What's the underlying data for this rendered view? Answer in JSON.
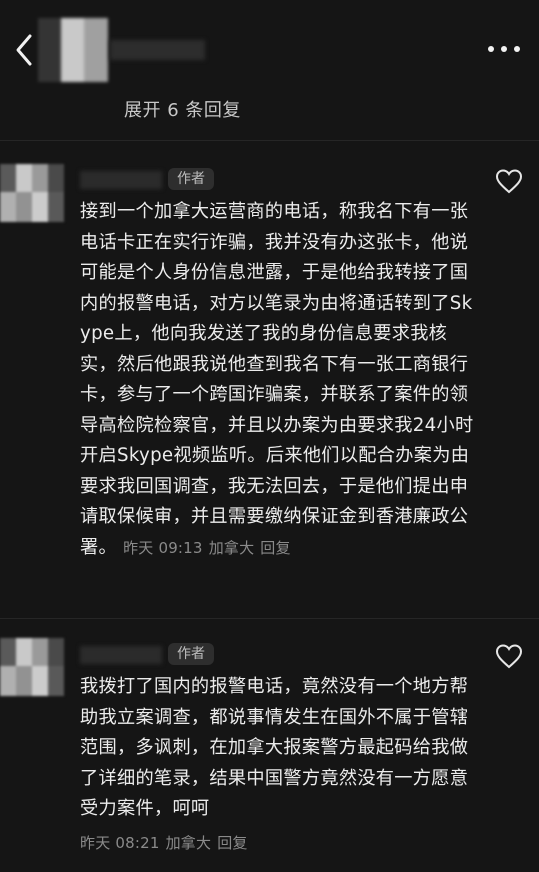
{
  "header": {
    "back_icon": "chevron-left-icon",
    "more_icon": "more-horizontal-icon",
    "expand_replies": "展开 6 条回复"
  },
  "comments": [
    {
      "author_badge": "作者",
      "text": "接到一个加拿大运营商的电话，称我名下有一张电话卡正在实行诈骗，我并没有办这张卡，他说可能是个人身份信息泄露，于是他给我转接了国内的报警电话，对方以笔录为由将通话转到了Skype上，他向我发送了我的身份信息要求我核实，然后他跟我说他查到我名下有一张工商银行卡，参与了一个跨国诈骗案，并联系了案件的领导高检院检察官，并且以办案为由要求我24小时开启Skype视频监听。后来他们以配合办案为由要求我回国调查，我无法回去，于是他们提出申请取保候审，并且需要缴纳保证金到香港廉政公署。",
      "time": "昨天 09:13",
      "location": "加拿大",
      "reply_label": "回复"
    },
    {
      "author_badge": "作者",
      "text": "我拨打了国内的报警电话，竟然没有一个地方帮助我立案调查，都说事情发生在国外不属于管辖范围，多讽刺，在加拿大报案警方最起码给我做了详细的笔录，结果中国警方竟然没有一方愿意受力案件，呵呵",
      "time": "昨天 08:21",
      "location": "加拿大",
      "reply_label": "回复"
    }
  ],
  "colors": {
    "background": "#151515",
    "text": "#ececec",
    "meta": "#8a8a8a",
    "badge_bg": "#2e2e2e"
  }
}
